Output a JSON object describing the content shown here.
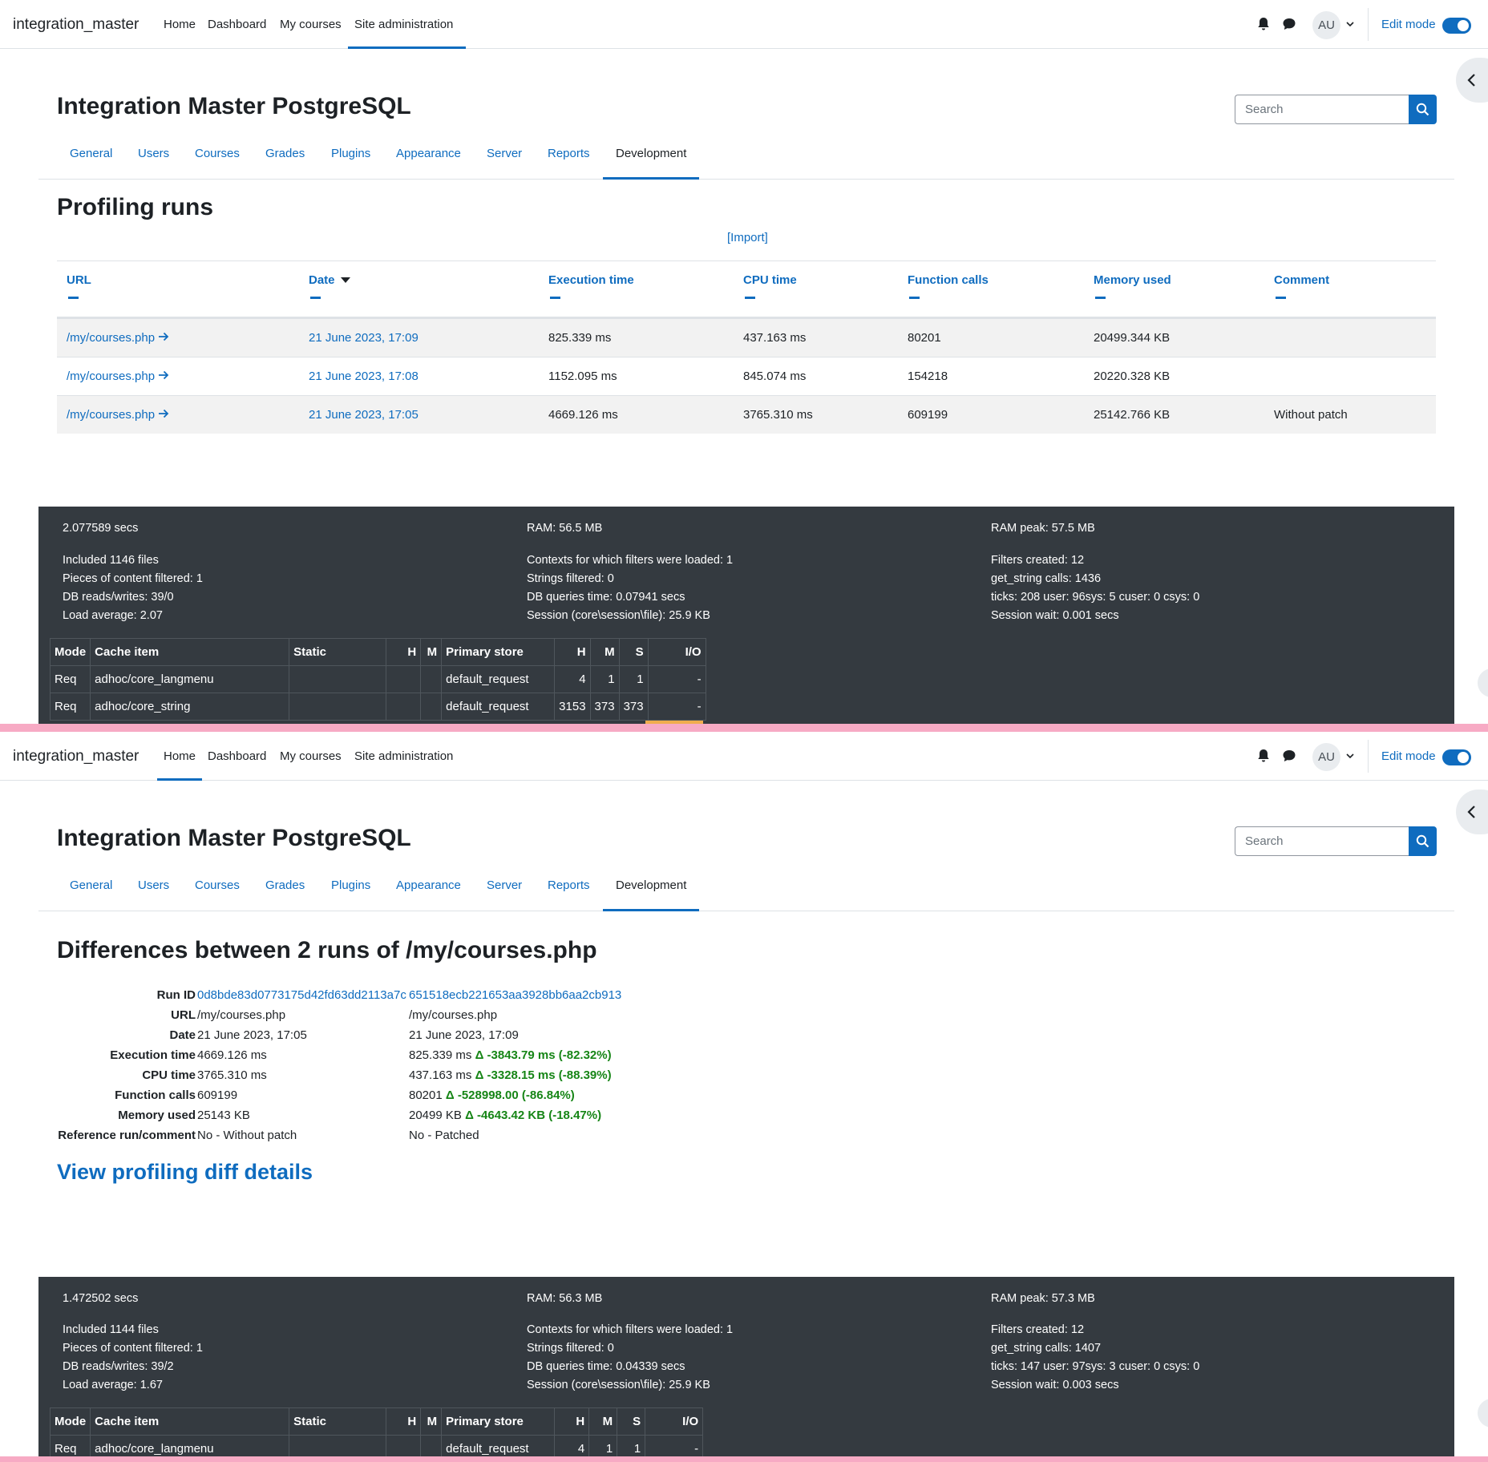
{
  "navbar": {
    "brand": "integration_master",
    "items": [
      "Home",
      "Dashboard",
      "My courses",
      "Site administration"
    ],
    "avatar": "AU",
    "edit_mode": "Edit mode"
  },
  "page": {
    "heading": "Integration Master PostgreSQL",
    "search_placeholder": "Search",
    "tabs": [
      "General",
      "Users",
      "Courses",
      "Grades",
      "Plugins",
      "Appearance",
      "Server",
      "Reports",
      "Development"
    ]
  },
  "panel1": {
    "active_nav": "Site administration",
    "title": "Profiling runs",
    "import_link": "[Import]",
    "columns": [
      "URL",
      "Date",
      "Execution time",
      "CPU time",
      "Function calls",
      "Memory used",
      "Comment"
    ],
    "rows": [
      [
        "/my/courses.php",
        "21 June 2023, 17:09",
        "825.339 ms",
        "437.163 ms",
        "80201",
        "20499.344 KB",
        ""
      ],
      [
        "/my/courses.php",
        "21 June 2023, 17:08",
        "1152.095 ms",
        "845.074 ms",
        "154218",
        "20220.328 KB",
        ""
      ],
      [
        "/my/courses.php",
        "21 June 2023, 17:05",
        "4669.126 ms",
        "3765.310 ms",
        "609199",
        "25142.766 KB",
        "Without patch"
      ]
    ],
    "footer": {
      "col1": [
        "2.077589 secs",
        "Included 1146 files",
        "Pieces of content filtered: 1",
        "DB reads/writes: 39/0",
        "Load average: 2.07"
      ],
      "col2": [
        "RAM: 56.5 MB",
        "Contexts for which filters were loaded: 1",
        "Strings filtered: 0",
        "DB queries time: 0.07941 secs",
        "Session (core\\session\\file): 25.9 KB"
      ],
      "col3": [
        "RAM peak: 57.5 MB",
        "Filters created: 12",
        "get_string calls: 1436",
        "ticks: 208 user: 96sys: 5 cuser: 0 csys: 0",
        "Session wait: 0.001 secs"
      ],
      "cache_rows": [
        [
          "Req",
          "adhoc/core_langmenu",
          "",
          "",
          "",
          "default_request",
          "4",
          "1",
          "1",
          "-"
        ],
        [
          "Req",
          "adhoc/core_string",
          "",
          "",
          "",
          "default_request",
          "3153",
          "373",
          "373",
          "-"
        ]
      ]
    }
  },
  "panel2": {
    "active_nav": "Home",
    "title": "Differences between 2 runs of /my/courses.php",
    "diff": [
      {
        "label": "Run ID",
        "a": "0d8bde83d0773175d42fd63dd2113a7c",
        "b": "651518ecb221653aa3928bb6aa2cb913",
        "delta": ""
      },
      {
        "label": "URL",
        "a": "/my/courses.php",
        "b": "/my/courses.php",
        "delta": ""
      },
      {
        "label": "Date",
        "a": "21 June 2023, 17:05",
        "b": "21 June 2023, 17:09",
        "delta": ""
      },
      {
        "label": "Execution time",
        "a": "4669.126 ms",
        "b": "825.339 ms",
        "delta": "Δ -3843.79 ms (-82.32%)"
      },
      {
        "label": "CPU time",
        "a": "3765.310 ms",
        "b": "437.163 ms",
        "delta": "Δ -3328.15 ms (-88.39%)"
      },
      {
        "label": "Function calls",
        "a": "609199",
        "b": "80201",
        "delta": "Δ -528998.00 (-86.84%)"
      },
      {
        "label": "Memory used",
        "a": "25143 KB",
        "b": "20499 KB",
        "delta": "Δ -4643.42 KB (-18.47%)"
      },
      {
        "label": "Reference run/comment",
        "a": "No - Without patch",
        "b": "No - Patched",
        "delta": ""
      }
    ],
    "details_link": "View profiling diff details",
    "footer": {
      "col1": [
        "1.472502 secs",
        "Included 1144 files",
        "Pieces of content filtered: 1",
        "DB reads/writes: 39/2",
        "Load average: 1.67"
      ],
      "col2": [
        "RAM: 56.3 MB",
        "Contexts for which filters were loaded: 1",
        "Strings filtered: 0",
        "DB queries time: 0.04339 secs",
        "Session (core\\session\\file): 25.9 KB"
      ],
      "col3": [
        "RAM peak: 57.3 MB",
        "Filters created: 12",
        "get_string calls: 1407",
        "ticks: 147 user: 97sys: 3 cuser: 0 csys: 0",
        "Session wait: 0.003 secs"
      ],
      "cache_rows": [
        [
          "Req",
          "adhoc/core_langmenu",
          "",
          "",
          "",
          "default_request",
          "4",
          "1",
          "1",
          "-"
        ]
      ]
    }
  },
  "cache_columns": [
    "Mode",
    "Cache item",
    "Static",
    "H",
    "M",
    "Primary store",
    "H",
    "M",
    "S",
    "I/O"
  ],
  "help_label": "?",
  "colors": {
    "accent": "#0f6cbf",
    "footer_bg": "#343a40",
    "positive_delta": "#168516",
    "divider": "#f7aac4"
  }
}
